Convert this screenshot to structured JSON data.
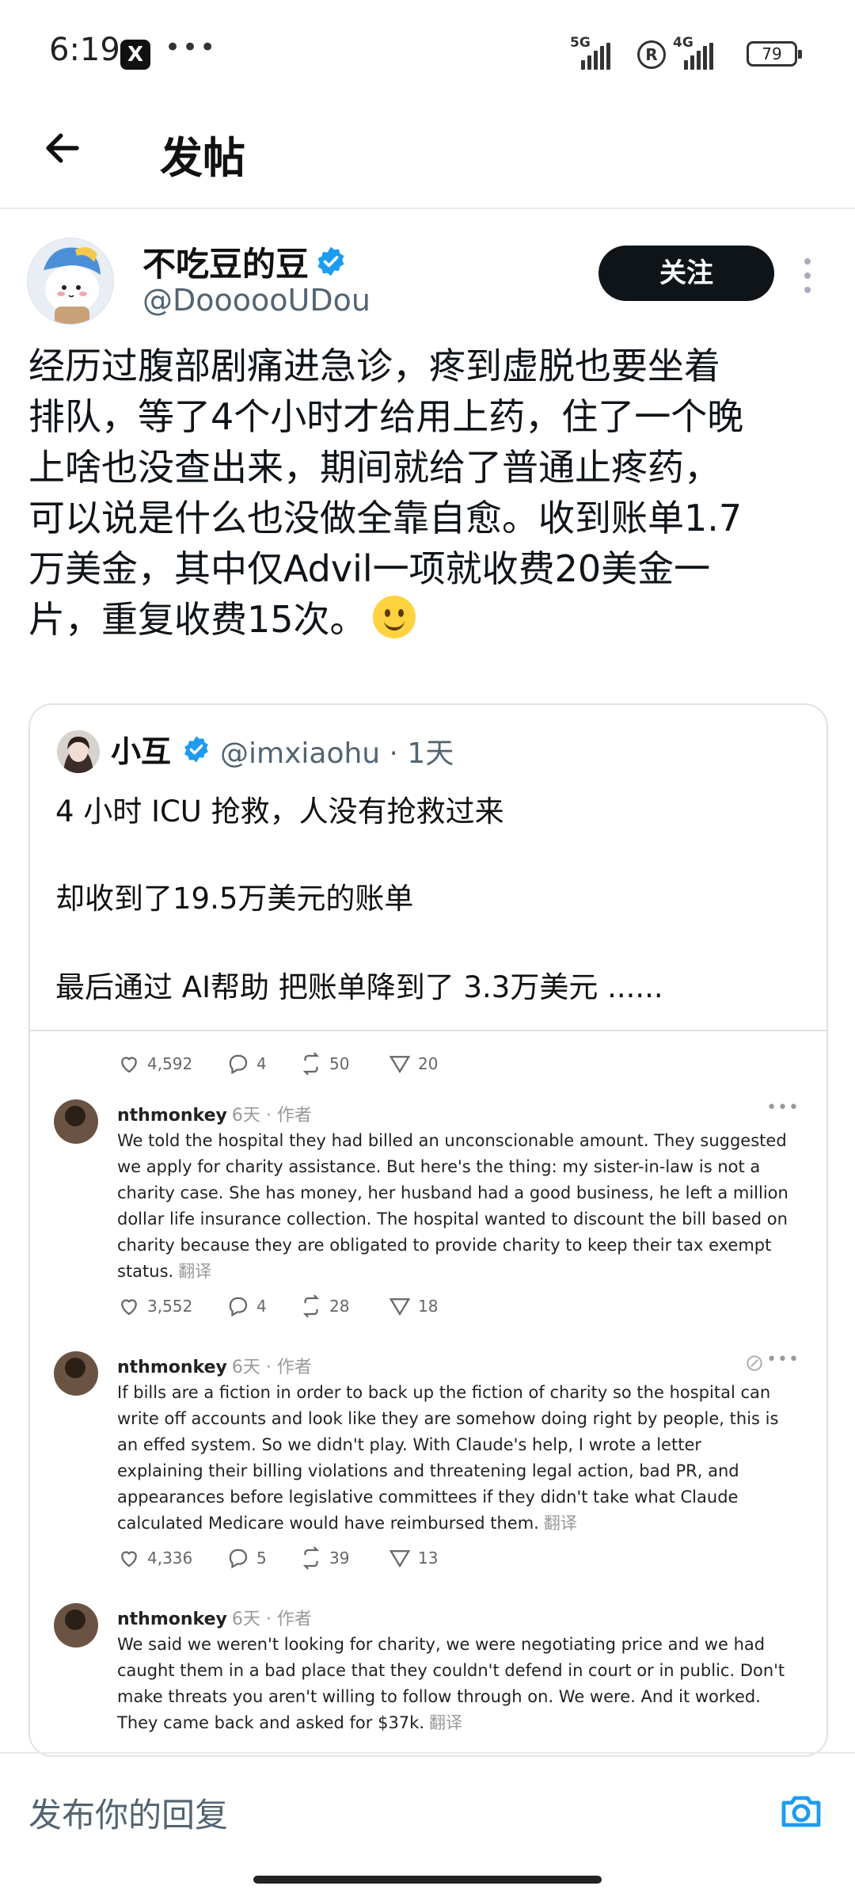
{
  "status_bar": {
    "time": "6:19",
    "x_app": "X",
    "more": "•••",
    "net1": "5G",
    "net2": "4G",
    "r_label": "R",
    "battery": "79"
  },
  "header": {
    "title": "发帖"
  },
  "post": {
    "display_name": "不吃豆的豆",
    "handle": "@DoooooUDou",
    "follow_label": "关注",
    "body": "经历过腹部剧痛进急诊，疼到虚脱也要坐着\n排队，等了4个小时才给用上药，住了一个晚\n上啥也没查出来，期间就给了普通止疼药，\n可以说是什么也没做全靠自愈。收到账单1.7\n万美金，其中仅Advil一项就收费20美金一\n片，重复收费15次。"
  },
  "quote": {
    "name": "小互",
    "handle_time": "@imxiaohu · 1天",
    "line1": "4 小时 ICU 抢救，人没有抢救过来",
    "line2": "却收到了19.5万美元的账单",
    "line3": "最后通过 AI帮助 把账单降到了 3.3万美元 ......"
  },
  "comments": {
    "top_actions": {
      "likes": "4,592",
      "replies": "4",
      "reposts": "50",
      "views": "20"
    },
    "items": [
      {
        "user": "nthmonkey",
        "meta": "6天 · 作者",
        "text": "We told the hospital they had billed an unconscionable amount. They suggested we apply for charity assistance. But here's the thing: my sister-in-law is not a charity case. She has money, her husband had a good business, he left a million dollar life insurance collection. The hospital wanted to discount the bill based on charity because they are obligated to provide charity to keep their tax exempt status.",
        "translate": "翻译",
        "likes": "3,552",
        "replies": "4",
        "reposts": "28",
        "views": "18"
      },
      {
        "user": "nthmonkey",
        "meta": "6天 · 作者",
        "text": "If bills are a fiction in order to back up the fiction of charity so the hospital can write off accounts and look like they are somehow doing right by people, this is an effed system. So we didn't play. With Claude's help, I wrote a letter explaining their billing violations and threatening legal action, bad PR, and appearances before legislative committees if they didn't take what Claude calculated Medicare would have reimbursed them.",
        "translate": "翻译",
        "likes": "4,336",
        "replies": "5",
        "reposts": "39",
        "views": "13"
      },
      {
        "user": "nthmonkey",
        "meta": "6天 · 作者",
        "text": "We said we weren't looking for charity, we were negotiating price and we had caught them in a bad place that they couldn't defend in court or in public. Don't make threats you aren't willing to follow through on. We were. And it worked. They came back and asked for $37k.",
        "translate": "翻译"
      }
    ]
  },
  "reply": {
    "placeholder": "发布你的回复"
  },
  "icons": [
    "back-arrow-icon",
    "verified-badge-icon",
    "more-vertical-icon",
    "like-icon",
    "reply-icon",
    "repost-icon",
    "views-icon",
    "camera-icon",
    "smile-emoji-icon"
  ]
}
